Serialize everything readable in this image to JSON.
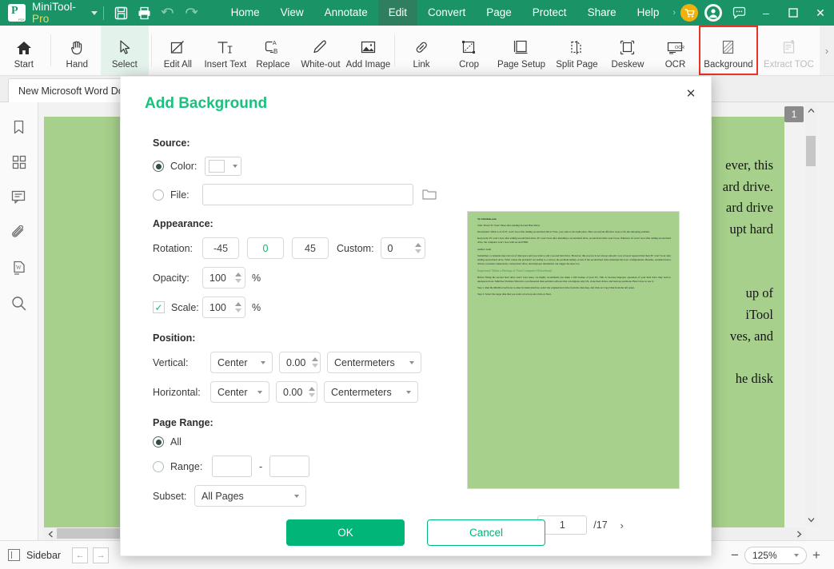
{
  "titlebar": {
    "app_name": "MiniTool-",
    "app_name_pro": "Pro",
    "menus": [
      {
        "label": "Home",
        "active": false
      },
      {
        "label": "View",
        "active": false
      },
      {
        "label": "Annotate",
        "active": false
      },
      {
        "label": "Edit",
        "active": true
      },
      {
        "label": "Convert",
        "active": false
      },
      {
        "label": "Page",
        "active": false
      },
      {
        "label": "Protect",
        "active": false
      },
      {
        "label": "Share",
        "active": false
      },
      {
        "label": "Help",
        "active": false
      }
    ],
    "overflow_arrow": "›",
    "minimize": "–",
    "maximize": "☐",
    "close": "✕"
  },
  "ribbon": {
    "items": [
      {
        "label": "Start",
        "icon": "home-icon",
        "state": "normal"
      },
      {
        "label": "Hand",
        "icon": "hand-icon",
        "state": "normal"
      },
      {
        "label": "Select",
        "icon": "cursor-icon",
        "state": "selected"
      },
      {
        "label": "Edit All",
        "icon": "edit-all-icon",
        "state": "normal"
      },
      {
        "label": "Insert Text",
        "icon": "insert-text-icon",
        "state": "normal"
      },
      {
        "label": "Replace",
        "icon": "replace-icon",
        "state": "normal"
      },
      {
        "label": "White-out",
        "icon": "whiteout-icon",
        "state": "normal"
      },
      {
        "label": "Add Image",
        "icon": "add-image-icon",
        "state": "normal"
      },
      {
        "label": "Link",
        "icon": "link-icon",
        "state": "normal"
      },
      {
        "label": "Crop",
        "icon": "crop-icon",
        "state": "normal"
      },
      {
        "label": "Page Setup",
        "icon": "page-setup-icon",
        "state": "normal"
      },
      {
        "label": "Split Page",
        "icon": "split-page-icon",
        "state": "normal"
      },
      {
        "label": "Deskew",
        "icon": "deskew-icon",
        "state": "normal"
      },
      {
        "label": "OCR",
        "icon": "ocr-icon",
        "state": "normal"
      },
      {
        "label": "Background",
        "icon": "background-icon",
        "state": "highlighted"
      },
      {
        "label": "Extract TOC",
        "icon": "extract-toc-icon",
        "state": "disabled"
      }
    ],
    "more_arrow": "›",
    "highlight_color": "#ee3322"
  },
  "tabbar": {
    "document_tab": "New Microsoft Word Do"
  },
  "rail": {
    "icons": [
      "bookmark-icon",
      "thumbnails-icon",
      "comment-icon",
      "attachment-icon",
      "word-icon",
      "search-icon"
    ]
  },
  "document": {
    "page_badge": "1",
    "visible_lines": [
      "ever, this",
      "ard drive.",
      "ard drive",
      "upt hard",
      "",
      "",
      "up of",
      "iTool",
      "ves, and",
      "",
      "he disk"
    ]
  },
  "statusbar": {
    "sidebar_label": "Sidebar",
    "prev_arrow": "←",
    "next_arrow": "→",
    "zoom_value": "125%",
    "zoom_minus": "−",
    "zoom_plus": "+"
  },
  "dialog": {
    "title": "Add Background",
    "close_icon": "✕",
    "source": {
      "label": "Source:",
      "color_label": "Color:",
      "color_selected": true,
      "color_value": "#ffffff",
      "file_label": "File:",
      "file_selected": false,
      "file_value": "",
      "file_placeholder": ""
    },
    "appearance": {
      "label": "Appearance:",
      "rotation_label": "Rotation:",
      "rotation_options": [
        {
          "label": "-45",
          "selected": false
        },
        {
          "label": "0",
          "selected": true
        },
        {
          "label": "45",
          "selected": false
        }
      ],
      "custom_label": "Custom:",
      "custom_value": "0",
      "opacity_label": "Opacity:",
      "opacity_value": "100",
      "opacity_unit": "%",
      "scale_checked": true,
      "scale_check_glyph": "✓",
      "scale_label": "Scale:",
      "scale_value": "100",
      "scale_unit": "%"
    },
    "position": {
      "label": "Position:",
      "vertical_label": "Vertical:",
      "vertical_align": "Center",
      "vertical_offset": "0.00",
      "vertical_unit": "Centermeters",
      "horizontal_label": "Horizontal:",
      "horizontal_align": "Center",
      "horizontal_offset": "0.00",
      "horizontal_unit": "Centermeters"
    },
    "page_range": {
      "label": "Page Range:",
      "all_label": "All",
      "all_selected": true,
      "range_label": "Range:",
      "range_selected": false,
      "range_from": "",
      "range_to": "",
      "range_dash": "-",
      "subset_label": "Subset:",
      "subset_value": "All Pages"
    },
    "preview": {
      "lines": [
        {
          "text": "To: bitrebels.com",
          "bold": true,
          "green": false
        },
        {
          "text": "Title: Fixed: PC Won’t Boot after Adding Second Hard Drive",
          "bold": false,
          "green": false
        },
        {
          "text": "Description: What to do if PC won’t boot after adding second hard drive? Now, you come to the right place. Here are several effective ways to fix the annoying problem.",
          "bold": false,
          "green": false
        },
        {
          "text": "Keywords: PC won’t boot after adding second hard drive, PC won’t boot after installing a second hard drive, second hard drive won’t boot, Windows 10 won’t boot after adding second hard drive, the computer won’t boot with second HDD",
          "bold": false,
          "green": false
        },
        {
          "text": "Author: Ariel",
          "bold": false,
          "green": false
        },
        {
          "text": "Sometimes a computer may run out of disk space and you want to add a second hard drive. However, this process is not always smooth. Lots of users reported that their PC won’t boot after adding second hard drive. What causes the problem? According to a survey, the problem mainly occurs if the second hard drive interrupts the boot configurations. Besides, outdated device drivers, loosened connections, corrupt hard drive, and improper installation can trigger the issue too.",
          "bold": false,
          "green": false
        },
        {
          "text": "Important! Make a Backup of Your Computer Beforehand",
          "bold": false,
          "green": true
        },
        {
          "text": "Before fixing the second hard drive won’t boot issue, we highly recommend you make a full backup of your PC. This is because improper operation of your hard drive may lead to unexpected loss. MiniTool Partition Wizard is a professional disk partition software that can migrate only OS, clone hard drives, and back up partitions. Here’s how to use it:",
          "bold": false,
          "green": false
        },
        {
          "text": "Step 1. Run the MiniTool software to enter its main interface, select the original hard drive from the disk map, and click on Copy Disk from the left panel.",
          "bold": false,
          "green": false
        },
        {
          "text": "Step 2. Select the target disk that you want to back up and click on Next.",
          "bold": false,
          "green": false
        }
      ],
      "page_current": "1",
      "page_total": "/17",
      "prev_icon": "‹",
      "next_icon": "›"
    },
    "ok_label": "OK",
    "cancel_label": "Cancel"
  },
  "colors": {
    "brand_green": "#1a9467",
    "accent_green": "#00b578",
    "title_green": "#17c27e",
    "page_green": "#a7d08c",
    "highlight_red": "#ee3322"
  }
}
